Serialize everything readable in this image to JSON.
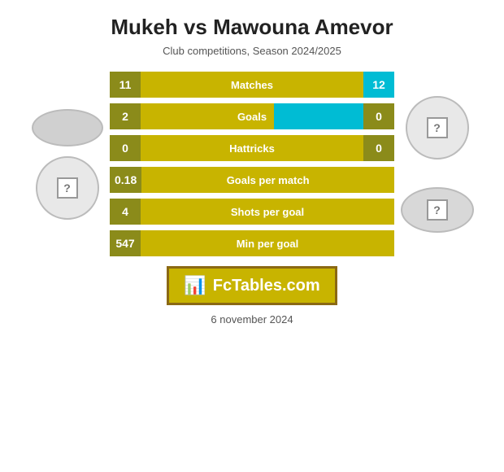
{
  "title": "Mukeh vs Mawouna Amevor",
  "subtitle": "Club competitions, Season 2024/2025",
  "stats": [
    {
      "id": "matches",
      "label": "Matches",
      "left_val": "11",
      "right_val": "12",
      "has_right_highlight": true,
      "has_left_val": true
    },
    {
      "id": "goals",
      "label": "Goals",
      "left_val": "2",
      "right_val": "0",
      "has_right_highlight": false,
      "has_left_val": true
    },
    {
      "id": "hattricks",
      "label": "Hattricks",
      "left_val": "0",
      "right_val": "0",
      "has_right_highlight": false,
      "has_left_val": true
    },
    {
      "id": "goals-per-match",
      "label": "Goals per match",
      "left_val": "0.18",
      "right_val": "",
      "has_right_highlight": false,
      "has_left_val": true,
      "no_right": true
    },
    {
      "id": "shots-per-goal",
      "label": "Shots per goal",
      "left_val": "4",
      "right_val": "",
      "has_right_highlight": false,
      "has_left_val": true,
      "no_right": true
    },
    {
      "id": "min-per-goal",
      "label": "Min per goal",
      "left_val": "547",
      "right_val": "",
      "has_right_highlight": false,
      "has_left_val": true,
      "no_right": true
    }
  ],
  "logo": {
    "text": "FcTables.com",
    "icon": "📊"
  },
  "date": "6 november 2024",
  "colors": {
    "bar_bg": "#c8b400",
    "bar_dark": "#8b8b1a",
    "highlight": "#00bcd4"
  }
}
